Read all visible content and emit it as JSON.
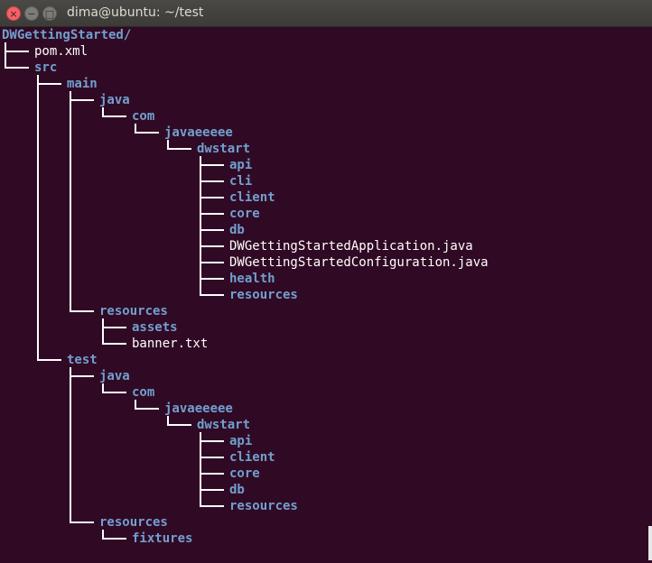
{
  "window": {
    "title": "dima@ubuntu: ~/test",
    "close_glyph": "×",
    "minimize_glyph": "−",
    "maximize_glyph": "□"
  },
  "tree": {
    "root": "DWGettingStarted/",
    "entries": [
      {
        "name": "pom.xml",
        "depth": 0,
        "type": "file"
      },
      {
        "name": "src",
        "depth": 0,
        "type": "dir"
      },
      {
        "name": "main",
        "depth": 1,
        "type": "dir"
      },
      {
        "name": "java",
        "depth": 2,
        "type": "dir"
      },
      {
        "name": "com",
        "depth": 3,
        "type": "dir"
      },
      {
        "name": "javaeeeee",
        "depth": 4,
        "type": "dir"
      },
      {
        "name": "dwstart",
        "depth": 5,
        "type": "dir"
      },
      {
        "name": "api",
        "depth": 6,
        "type": "dir"
      },
      {
        "name": "cli",
        "depth": 6,
        "type": "dir"
      },
      {
        "name": "client",
        "depth": 6,
        "type": "dir"
      },
      {
        "name": "core",
        "depth": 6,
        "type": "dir"
      },
      {
        "name": "db",
        "depth": 6,
        "type": "dir"
      },
      {
        "name": "DWGettingStartedApplication.java",
        "depth": 6,
        "type": "file"
      },
      {
        "name": "DWGettingStartedConfiguration.java",
        "depth": 6,
        "type": "file"
      },
      {
        "name": "health",
        "depth": 6,
        "type": "dir"
      },
      {
        "name": "resources",
        "depth": 6,
        "type": "dir"
      },
      {
        "name": "resources",
        "depth": 2,
        "type": "dir"
      },
      {
        "name": "assets",
        "depth": 3,
        "type": "dir"
      },
      {
        "name": "banner.txt",
        "depth": 3,
        "type": "file"
      },
      {
        "name": "test",
        "depth": 1,
        "type": "dir"
      },
      {
        "name": "java",
        "depth": 2,
        "type": "dir"
      },
      {
        "name": "com",
        "depth": 3,
        "type": "dir"
      },
      {
        "name": "javaeeeee",
        "depth": 4,
        "type": "dir"
      },
      {
        "name": "dwstart",
        "depth": 5,
        "type": "dir"
      },
      {
        "name": "api",
        "depth": 6,
        "type": "dir"
      },
      {
        "name": "client",
        "depth": 6,
        "type": "dir"
      },
      {
        "name": "core",
        "depth": 6,
        "type": "dir"
      },
      {
        "name": "db",
        "depth": 6,
        "type": "dir"
      },
      {
        "name": "resources",
        "depth": 6,
        "type": "dir"
      },
      {
        "name": "resources",
        "depth": 2,
        "type": "dir"
      },
      {
        "name": "fixtures",
        "depth": 3,
        "type": "dir"
      }
    ]
  },
  "colors": {
    "background": "#300a24",
    "directory": "#729fcf",
    "file": "#ffffff",
    "tree_lines": "#ffffff"
  }
}
